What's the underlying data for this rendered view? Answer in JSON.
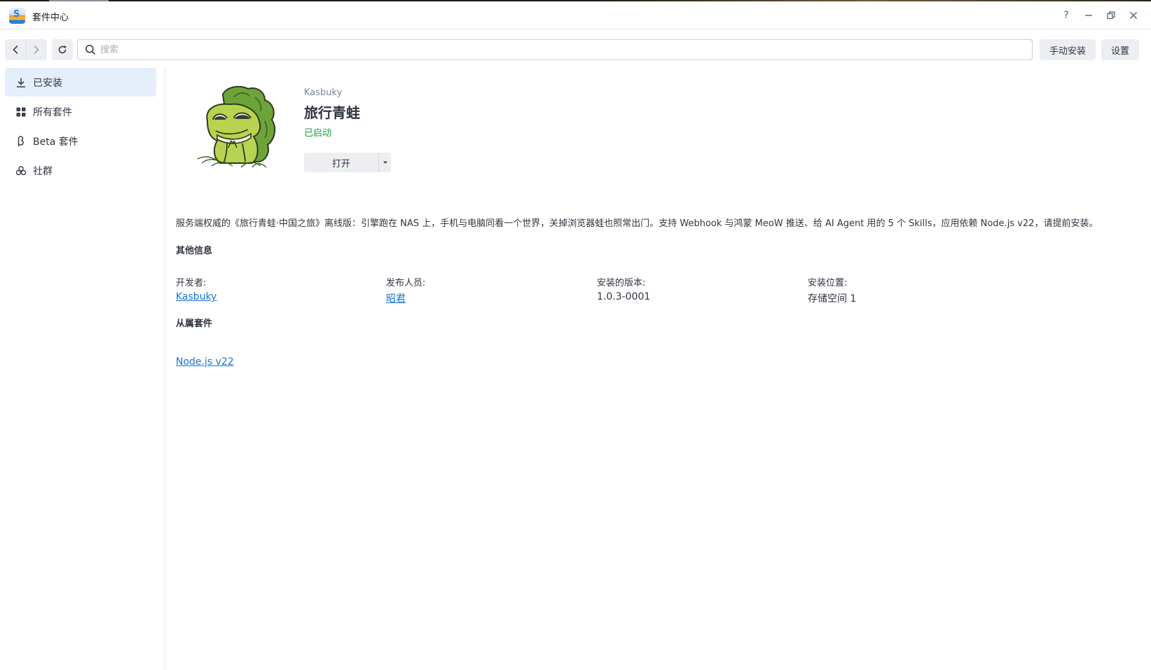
{
  "window": {
    "title": "套件中心",
    "app_icon_letter": "S"
  },
  "toolbar": {
    "search_placeholder": "搜索",
    "manual_install_label": "手动安装",
    "settings_label": "设置"
  },
  "sidebar": {
    "items": [
      {
        "label": "已安装",
        "icon": "download-icon",
        "active": true
      },
      {
        "label": "所有套件",
        "icon": "grid-icon",
        "active": false
      },
      {
        "label": "Beta 套件",
        "icon": "beta-icon",
        "active": false
      },
      {
        "label": "社群",
        "icon": "community-icon",
        "active": false
      }
    ]
  },
  "package": {
    "publisher": "Kasbuky",
    "name": "旅行青蛙",
    "status": "已启动",
    "open_label": "打开",
    "description": "服务端权威的《旅行青蛙·中国之旅》离线版：引擎跑在 NAS 上，手机与电脑同看一个世界，关掉浏览器蛙也照常出门。支持 Webhook 与鸿蒙 MeoW 推送、给 AI Agent 用的 5 个 Skills，应用依赖 Node.js v22，请提前安装。"
  },
  "other_info": {
    "title": "其他信息",
    "developer_label": "开发者:",
    "developer_value": "Kasbuky",
    "publisher_label": "发布人员:",
    "publisher_value": "昭君",
    "version_label": "安装的版本:",
    "version_value": "1.0.3-0001",
    "location_label": "安装位置:",
    "location_value": "存储空间 1"
  },
  "dependencies": {
    "title": "从属套件",
    "items": [
      "Node.js v22"
    ]
  },
  "colors": {
    "accent": "#1673d2",
    "status_running": "#1aa33a",
    "active_item_bg": "#e5eefb"
  }
}
